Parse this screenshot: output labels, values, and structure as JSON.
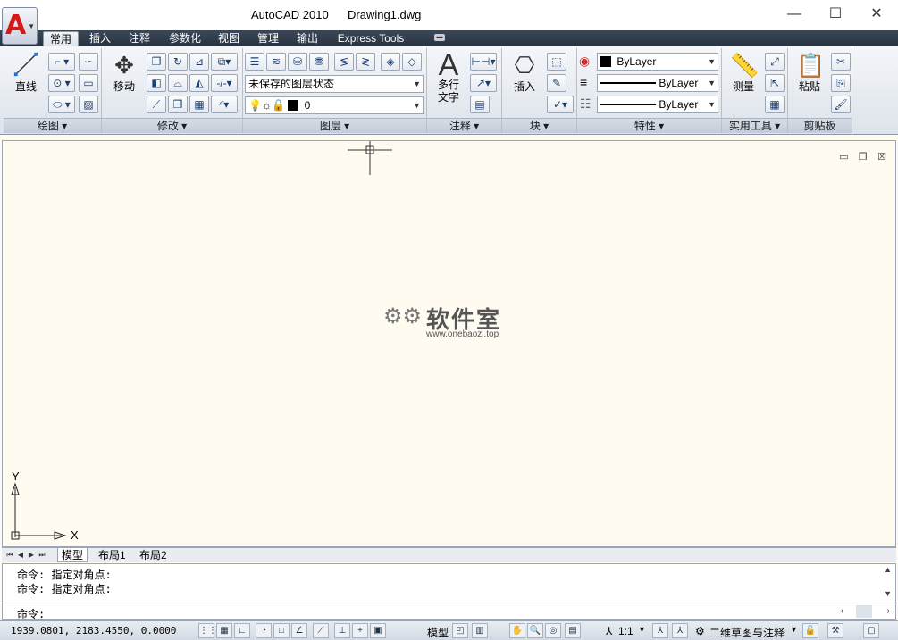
{
  "window": {
    "app_title": "AutoCAD 2010",
    "doc_title": "Drawing1.dwg",
    "minimize": "—",
    "maximize": "☐",
    "close": "✕"
  },
  "tabs": [
    {
      "label": "常用"
    },
    {
      "label": "插入"
    },
    {
      "label": "注释"
    },
    {
      "label": "参数化"
    },
    {
      "label": "视图"
    },
    {
      "label": "管理"
    },
    {
      "label": "输出"
    },
    {
      "label": "Express Tools"
    }
  ],
  "panels": {
    "draw": {
      "title": "绘图",
      "line_label": "直线"
    },
    "modify": {
      "title": "修改",
      "move_label": "移动"
    },
    "layers": {
      "title": "图层",
      "state_value": "未保存的图层状态",
      "layer_value": "0"
    },
    "annotation": {
      "title": "注释",
      "mtext_label_1": "多行",
      "mtext_label_2": "文字"
    },
    "block": {
      "title": "块",
      "insert_label": "插入"
    },
    "properties": {
      "title": "特性",
      "color_value": "ByLayer",
      "linetype_value": "ByLayer",
      "lineweight_value": "ByLayer"
    },
    "utilities": {
      "title": "实用工具",
      "measure_label": "测量"
    },
    "clipboard": {
      "title": "剪贴板",
      "paste_label": "粘贴"
    }
  },
  "drawing": {
    "ucs_y": "Y",
    "ucs_x": "X",
    "watermark_text": "软件室",
    "watermark_url": "www.onebaozi.top"
  },
  "layout_tabs": [
    {
      "label": "模型"
    },
    {
      "label": "布局1"
    },
    {
      "label": "布局2"
    }
  ],
  "command": {
    "history": [
      "命令: 指定对角点:",
      "命令: 指定对角点:"
    ],
    "prompt": "命令:"
  },
  "status": {
    "coords": "1939.0801, 2183.4550, 0.0000",
    "model_label": "模型",
    "scale_label": "1:1",
    "workspace_label": "二维草图与注释"
  },
  "colors": {
    "drawing_bg": "#fffbf0",
    "ribbon_tabbar": "#2f3b49",
    "accent": "#d21a1a"
  }
}
